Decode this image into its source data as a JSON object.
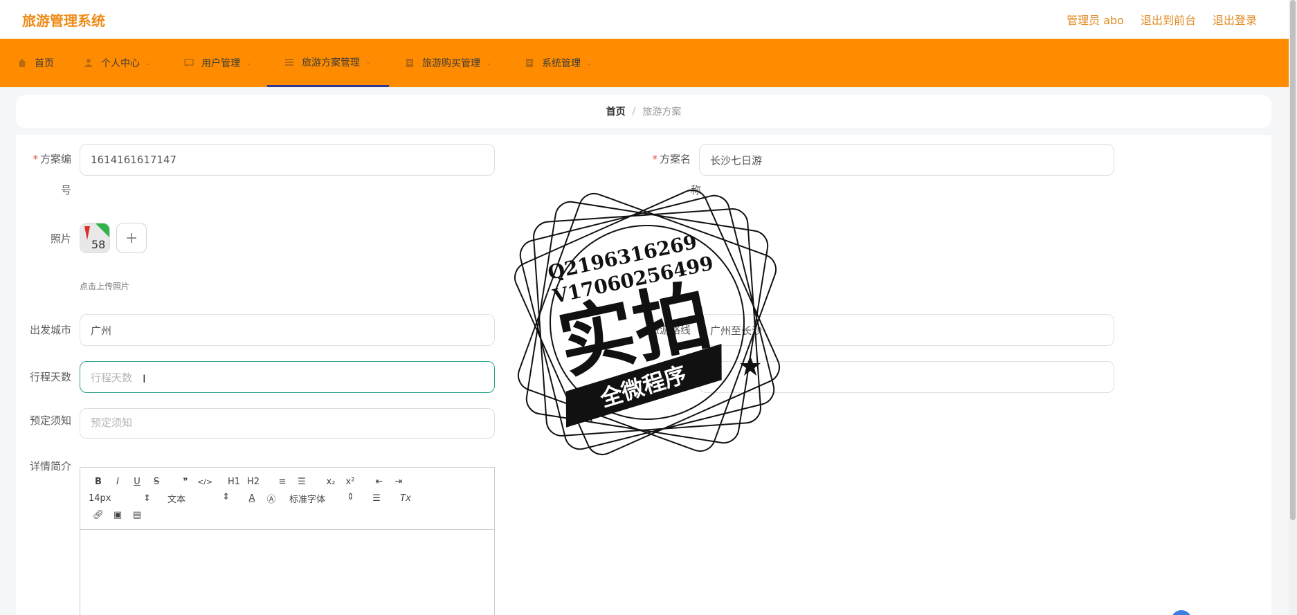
{
  "header": {
    "app_title": "旅游管理系统",
    "admin_label": "管理员 abo",
    "back_to_front": "退出到前台",
    "logout": "退出登录"
  },
  "nav": {
    "items": [
      {
        "label": "首页",
        "icon": "home-icon"
      },
      {
        "label": "个人中心",
        "icon": "user-icon"
      },
      {
        "label": "用户管理",
        "icon": "chat-icon"
      },
      {
        "label": "旅游方案管理",
        "icon": "list-icon"
      },
      {
        "label": "旅游购买管理",
        "icon": "doc-icon"
      },
      {
        "label": "系统管理",
        "icon": "doc-icon"
      }
    ],
    "active_index": 3
  },
  "breadcrumb": {
    "home": "首页",
    "separator": "/",
    "current": "旅游方案"
  },
  "form": {
    "plan_no": {
      "label_line1": "方案编",
      "label_line2": "号",
      "value": "1614161617147"
    },
    "plan_name": {
      "label_line1": "方案名",
      "label_line2": "称",
      "value": "长沙七日游"
    },
    "photo": {
      "label": "照片",
      "hint": "点击上传照片",
      "add": "+"
    },
    "departure_city": {
      "label": "出发城市",
      "value": "广州"
    },
    "route": {
      "label": "旅游路线",
      "value": "广州至长沙"
    },
    "days": {
      "label": "行程天数",
      "placeholder": "行程天数"
    },
    "notice": {
      "label": "预定须知",
      "placeholder": "预定须知"
    },
    "detail": {
      "label": "详情简介"
    }
  },
  "editor": {
    "row1": [
      "B",
      "I",
      "U",
      "S",
      "❞",
      "</>",
      "H1",
      "H2",
      "≡",
      "☰",
      "x₂",
      "x²",
      "⇤",
      "⇥"
    ],
    "font_size": "14px",
    "text_type": "文本",
    "font_family": "标准字体"
  },
  "watermark": {
    "contact1": "Q2196316269",
    "contact2": "V17060256499",
    "big": "实拍",
    "banner": "全微程序"
  }
}
